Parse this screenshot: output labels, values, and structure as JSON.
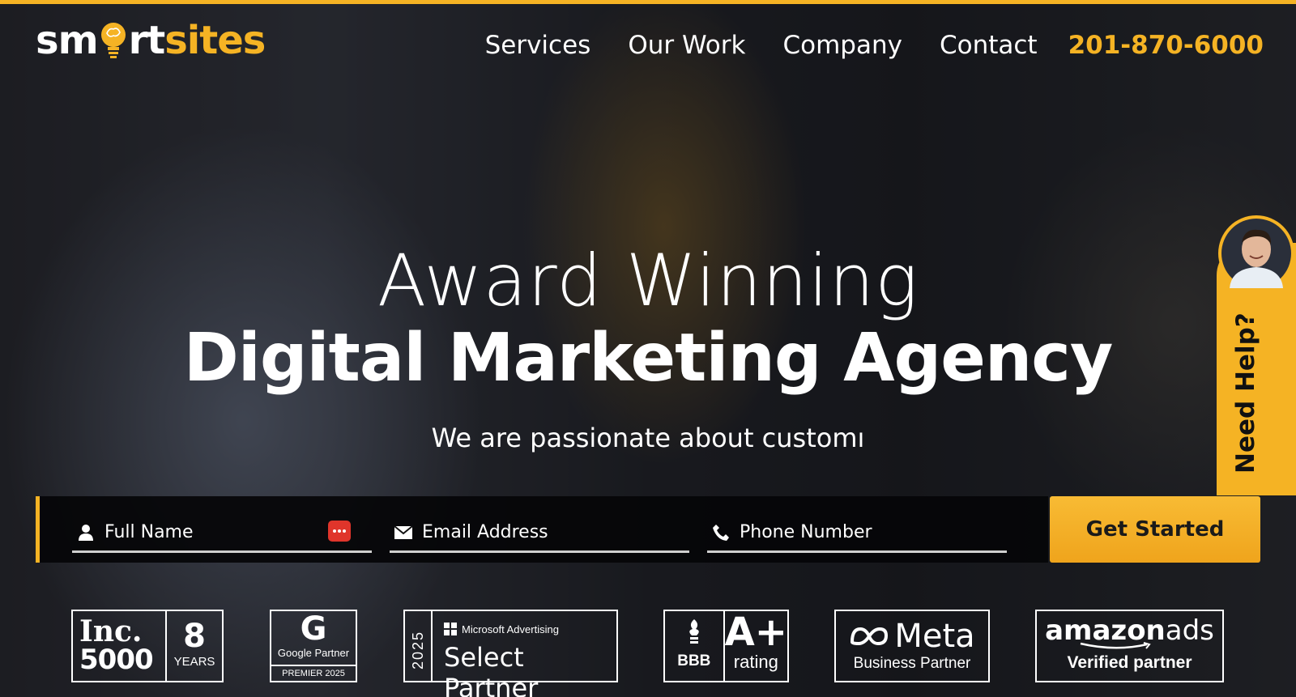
{
  "header": {
    "logo": {
      "part1": "sm",
      "part2": "rt",
      "part3": "sites"
    },
    "nav": [
      {
        "label": "Services"
      },
      {
        "label": "Our Work"
      },
      {
        "label": "Company"
      },
      {
        "label": "Contact"
      }
    ],
    "phone": "201-870-6000"
  },
  "hero": {
    "title_line1": "Award Winning",
    "title_line2": "Digital Marketing Agency",
    "subtitle": "We are passionate about customı"
  },
  "form": {
    "full_name_placeholder": "Full Name",
    "email_placeholder": "Email Address",
    "phone_placeholder": "Phone Number",
    "submit_label": "Get Started"
  },
  "help": {
    "label": "Need Help?"
  },
  "badges": {
    "inc": {
      "line1": "Inc.",
      "line2": "5000",
      "years_number": "8",
      "years_label": "YEARS"
    },
    "google": {
      "letter": "G",
      "name": "Google Partner",
      "tier": "PREMIER 2025"
    },
    "microsoft": {
      "year": "2025",
      "brand": "Microsoft Advertising",
      "title": "Select Partner"
    },
    "bbb": {
      "logo_text": "BBB",
      "grade": "A+",
      "rating_label": "rating"
    },
    "meta": {
      "brand": "Meta",
      "label": "Business Partner"
    },
    "amazon": {
      "brand_bold": "amazon",
      "brand_light": "ads",
      "label": "Verified partner"
    }
  },
  "colors": {
    "accent": "#f5b324",
    "text": "#ffffff",
    "button_text": "#1a1a1a"
  }
}
